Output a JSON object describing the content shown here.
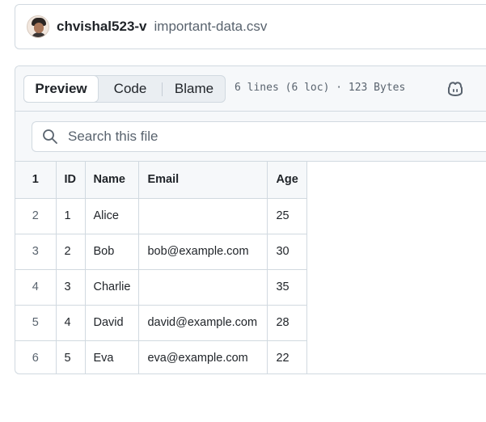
{
  "header": {
    "owner": "chvishal523-v",
    "filename": "important-data.csv"
  },
  "toolbar": {
    "tabs": [
      {
        "label": "Preview",
        "active": true
      },
      {
        "label": "Code",
        "active": false
      },
      {
        "label": "Blame",
        "active": false
      }
    ],
    "file_info": "6 lines (6 loc) · 123 Bytes",
    "copilot_icon": "copilot-icon"
  },
  "search": {
    "placeholder": "Search this file"
  },
  "table": {
    "header_line_number": "1",
    "columns": [
      "ID",
      "Name",
      "Email",
      "Age"
    ],
    "rows": [
      {
        "line": "2",
        "cells": [
          "1",
          "Alice",
          "",
          "25"
        ]
      },
      {
        "line": "3",
        "cells": [
          "2",
          "Bob",
          "bob@example.com",
          "30"
        ]
      },
      {
        "line": "4",
        "cells": [
          "3",
          "Charlie",
          "",
          "35"
        ]
      },
      {
        "line": "5",
        "cells": [
          "4",
          "David",
          "david@example.com",
          "28"
        ]
      },
      {
        "line": "6",
        "cells": [
          "5",
          "Eva",
          "eva@example.com",
          "22"
        ]
      }
    ]
  },
  "colors": {
    "border": "#d1d9e0",
    "muted_text": "#59636e",
    "panel_bg": "#f6f8fa"
  }
}
